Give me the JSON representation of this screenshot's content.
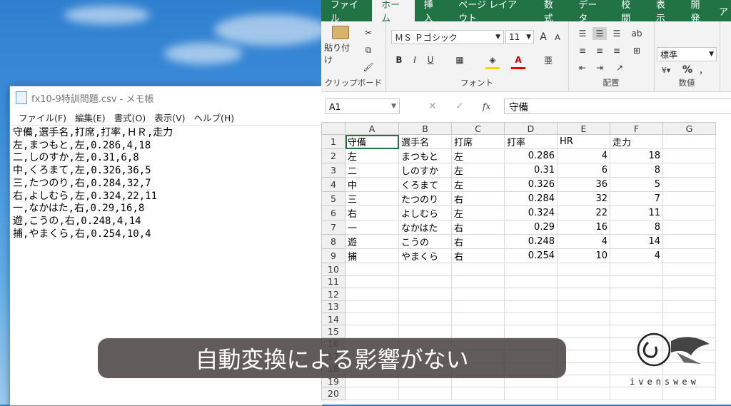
{
  "notepad": {
    "title": "fx10-9特訓問題.csv - メモ帳",
    "menu": [
      "ファイル(F)",
      "編集(E)",
      "書式(O)",
      "表示(V)",
      "ヘルプ(H)"
    ],
    "lines": [
      "守備,選手名,打席,打率,ＨＲ,走力",
      "左,まつもと,左,0.286,4,18",
      "二,しのすか,左,0.31,6,8",
      "中,くろまて,左,0.326,36,5",
      "三,たつのり,右,0.284,32,7",
      "右,よしむら,左,0.324,22,11",
      "一,なかはた,右,0.29,16,8",
      "遊,こうの,右,0.248,4,14",
      "捕,やまくら,右,0.254,10,4"
    ]
  },
  "excel": {
    "tabs": [
      "ファイル",
      "ホーム",
      "挿入",
      "ページ レイアウト",
      "数式",
      "データ",
      "校閲",
      "表示",
      "開発",
      "ア"
    ],
    "active_tab": 1,
    "ribbon": {
      "paste_label": "貼り付け",
      "clipboard_label": "クリップボード",
      "font_name": "ＭＳ Ｐゴシック",
      "font_size": "11",
      "font_label": "フォント",
      "align_label": "配置",
      "number_format": "標準",
      "number_label": "数値",
      "bold": "B",
      "italic": "I",
      "underline": "U",
      "grow": "A",
      "shrink": "A",
      "percent": "%",
      "comma": "，"
    },
    "name_box": "A1",
    "formula": "守備",
    "fx": "fx",
    "columns": [
      "A",
      "B",
      "C",
      "D",
      "E",
      "F",
      "G"
    ],
    "rows": [
      [
        "守備",
        "選手名",
        "打席",
        "打率",
        "HR",
        "走力",
        ""
      ],
      [
        "左",
        "まつもと",
        "左",
        "0.286",
        "4",
        "18",
        ""
      ],
      [
        "二",
        "しのすか",
        "左",
        "0.31",
        "6",
        "8",
        ""
      ],
      [
        "中",
        "くろまて",
        "左",
        "0.326",
        "36",
        "5",
        ""
      ],
      [
        "三",
        "たつのり",
        "右",
        "0.284",
        "32",
        "7",
        ""
      ],
      [
        "右",
        "よしむら",
        "左",
        "0.324",
        "22",
        "11",
        ""
      ],
      [
        "一",
        "なかはた",
        "右",
        "0.29",
        "16",
        "8",
        ""
      ],
      [
        "遊",
        "こうの",
        "右",
        "0.248",
        "4",
        "14",
        ""
      ],
      [
        "捕",
        "やまくら",
        "右",
        "0.254",
        "10",
        "4",
        ""
      ],
      [
        "",
        "",
        "",
        "",
        "",
        "",
        ""
      ],
      [
        "",
        "",
        "",
        "",
        "",
        "",
        ""
      ],
      [
        "",
        "",
        "",
        "",
        "",
        "",
        ""
      ],
      [
        "",
        "",
        "",
        "",
        "",
        "",
        ""
      ],
      [
        "",
        "",
        "",
        "",
        "",
        "",
        ""
      ],
      [
        "",
        "",
        "",
        "",
        "",
        "",
        ""
      ],
      [
        "",
        "",
        "",
        "",
        "",
        "",
        ""
      ],
      [
        "",
        "",
        "",
        "",
        "",
        "",
        ""
      ],
      [
        "",
        "",
        "",
        "",
        "",
        "",
        ""
      ],
      [
        "",
        "",
        "",
        "",
        "",
        "",
        ""
      ],
      [
        "",
        "",
        "",
        "",
        "",
        "",
        ""
      ]
    ]
  },
  "caption": "自動変換による影響がない",
  "logo_text": "ivenswew",
  "colors": {
    "excel_green": "#217346",
    "caption_bg": "#4b4644"
  }
}
